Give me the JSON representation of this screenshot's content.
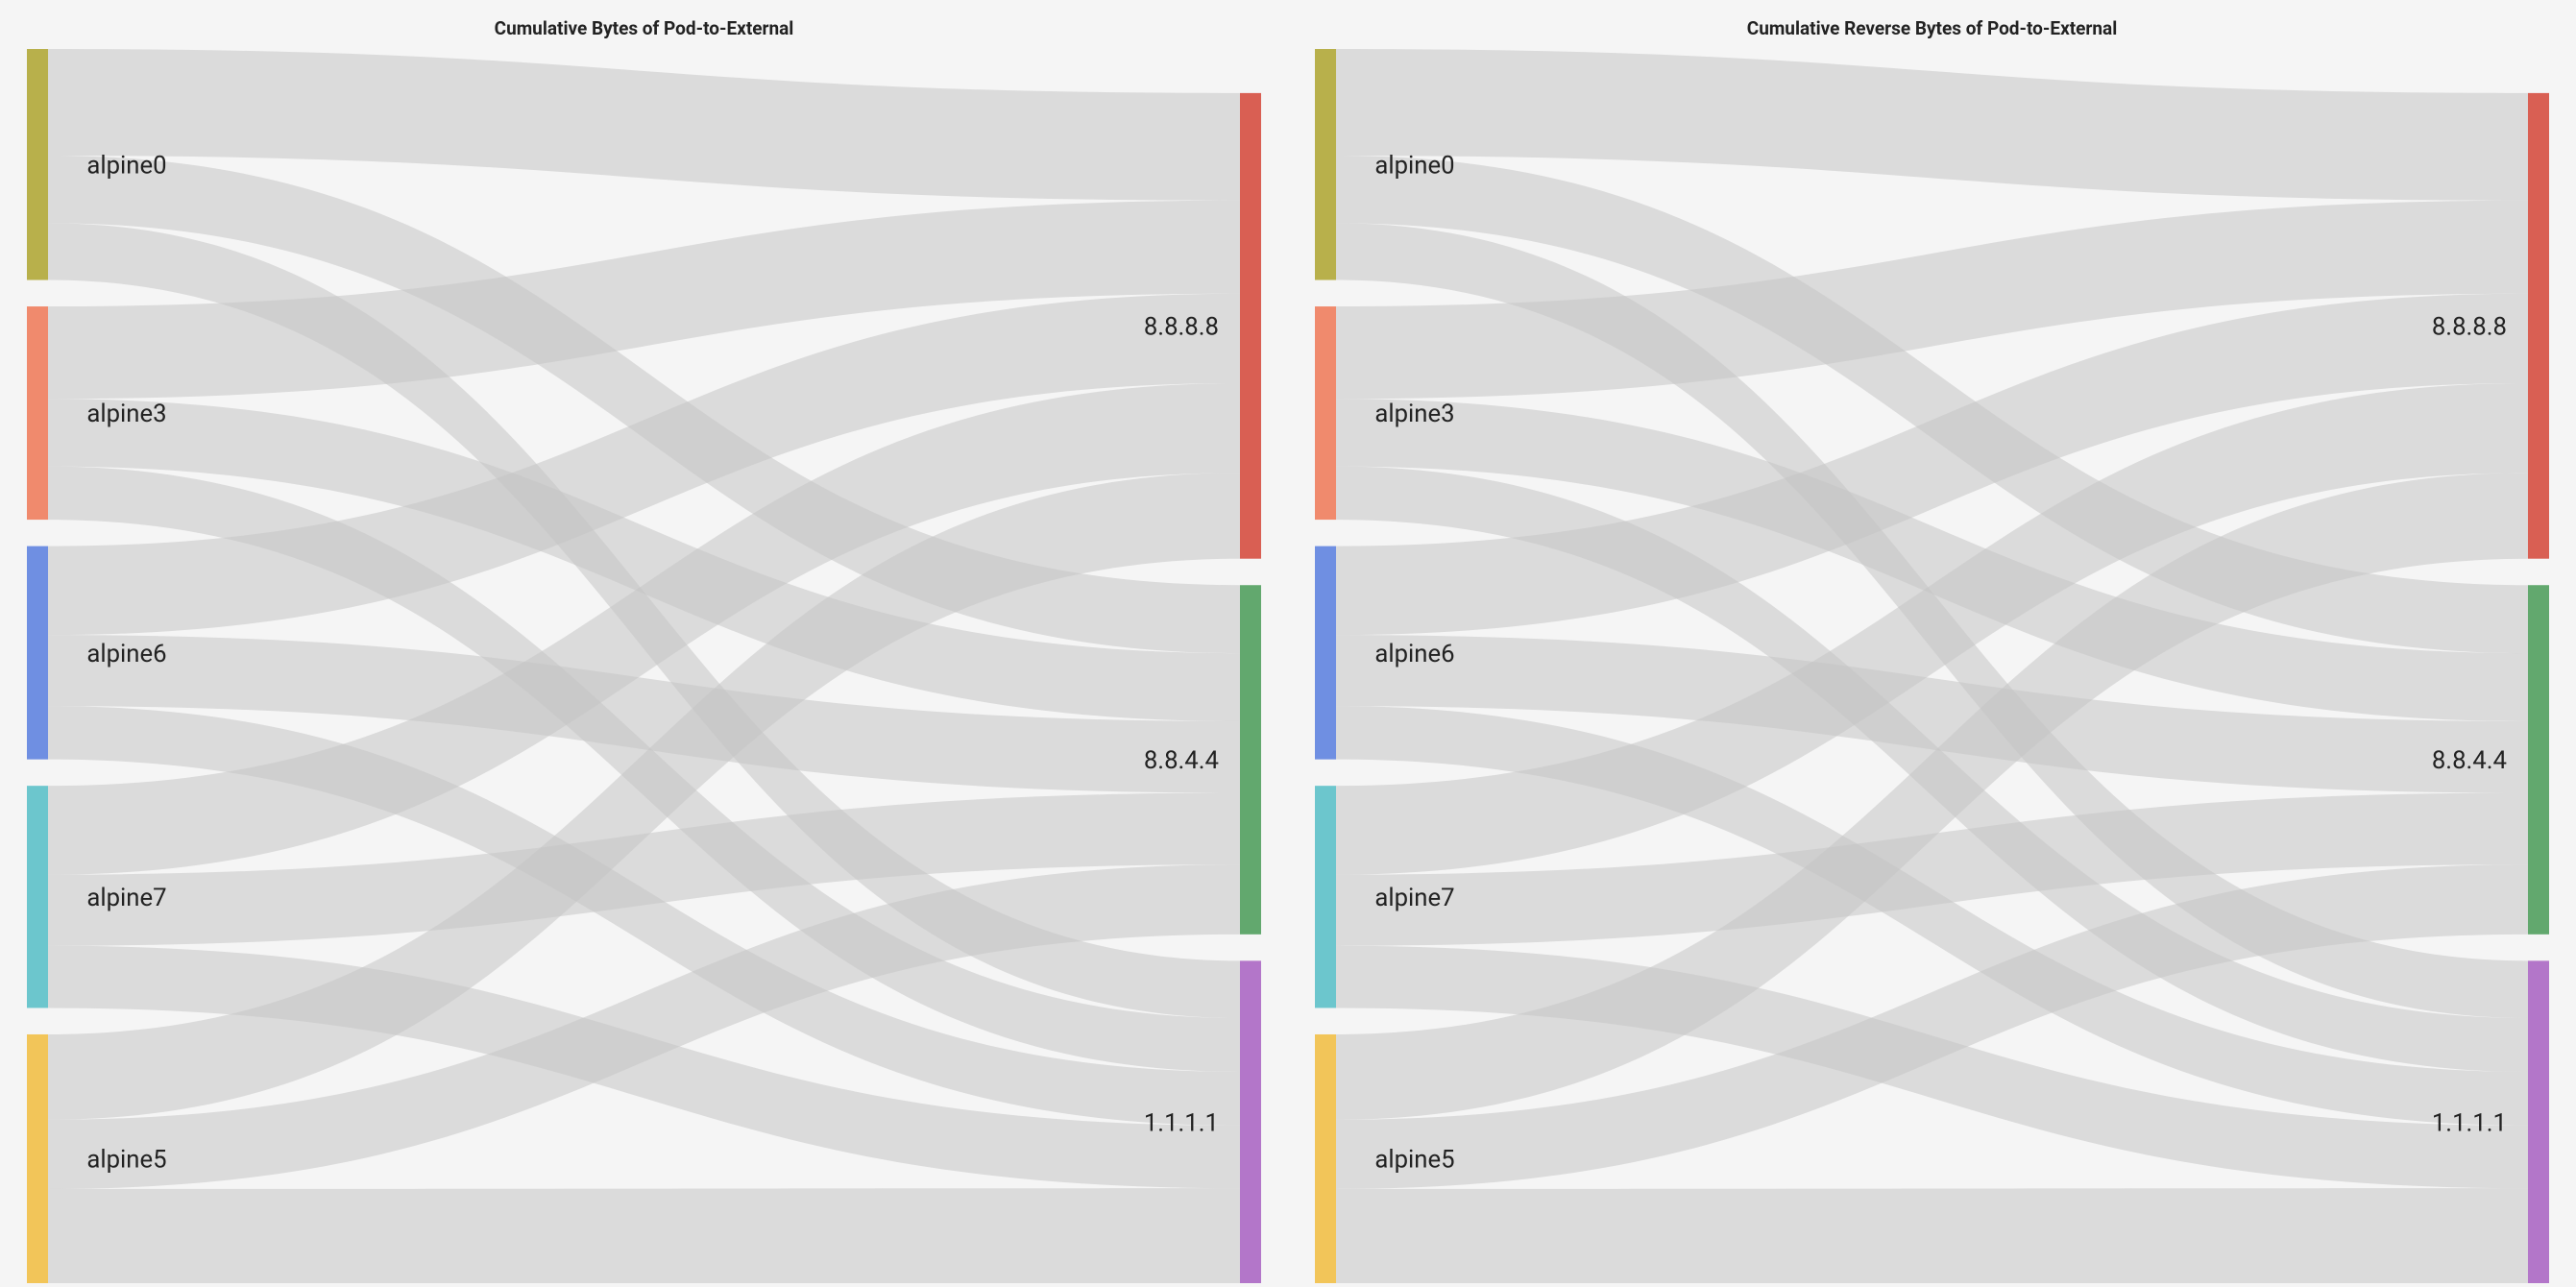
{
  "panels": [
    {
      "title": "Cumulative Bytes of Pod-to-External"
    },
    {
      "title": "Cumulative Reverse Bytes of Pod-to-External"
    }
  ],
  "chart_data": [
    {
      "type": "sankey",
      "title": "Cumulative Bytes of Pod-to-External",
      "sources": [
        "alpine0",
        "alpine3",
        "alpine6",
        "alpine7",
        "alpine5"
      ],
      "targets": [
        "8.8.8.8",
        "8.8.4.4",
        "1.1.1.1"
      ],
      "source_totals": {
        "alpine0": 130,
        "alpine3": 120,
        "alpine6": 120,
        "alpine7": 125,
        "alpine5": 140
      },
      "target_totals": {
        "8.8.8.8": 260,
        "8.8.4.4": 195,
        "1.1.1.1": 180
      },
      "flows": [
        {
          "source": "alpine0",
          "target": "8.8.8.8",
          "value": 60
        },
        {
          "source": "alpine0",
          "target": "8.8.4.4",
          "value": 38
        },
        {
          "source": "alpine0",
          "target": "1.1.1.1",
          "value": 32
        },
        {
          "source": "alpine3",
          "target": "8.8.8.8",
          "value": 52
        },
        {
          "source": "alpine3",
          "target": "8.8.4.4",
          "value": 38
        },
        {
          "source": "alpine3",
          "target": "1.1.1.1",
          "value": 30
        },
        {
          "source": "alpine6",
          "target": "8.8.8.8",
          "value": 50
        },
        {
          "source": "alpine6",
          "target": "8.8.4.4",
          "value": 40
        },
        {
          "source": "alpine6",
          "target": "1.1.1.1",
          "value": 30
        },
        {
          "source": "alpine7",
          "target": "8.8.8.8",
          "value": 50
        },
        {
          "source": "alpine7",
          "target": "8.8.4.4",
          "value": 40
        },
        {
          "source": "alpine7",
          "target": "1.1.1.1",
          "value": 35
        },
        {
          "source": "alpine5",
          "target": "8.8.8.8",
          "value": 48
        },
        {
          "source": "alpine5",
          "target": "8.8.4.4",
          "value": 39
        },
        {
          "source": "alpine5",
          "target": "1.1.1.1",
          "value": 53
        }
      ],
      "colors": {
        "alpine0": "#b8b04b",
        "alpine3": "#f08a6d",
        "alpine6": "#6f8fe2",
        "alpine7": "#6cc6cd",
        "alpine5": "#f2c559",
        "8.8.8.8": "#d95f53",
        "8.8.4.4": "#62a86e",
        "1.1.1.1": "#b376c9"
      },
      "link_color": "#c4c4c4"
    },
    {
      "type": "sankey",
      "title": "Cumulative Reverse Bytes of Pod-to-External",
      "sources": [
        "alpine0",
        "alpine3",
        "alpine6",
        "alpine7",
        "alpine5"
      ],
      "targets": [
        "8.8.8.8",
        "8.8.4.4",
        "1.1.1.1"
      ],
      "source_totals": {
        "alpine0": 130,
        "alpine3": 120,
        "alpine6": 120,
        "alpine7": 125,
        "alpine5": 140
      },
      "target_totals": {
        "8.8.8.8": 260,
        "8.8.4.4": 195,
        "1.1.1.1": 180
      },
      "flows": [
        {
          "source": "alpine0",
          "target": "8.8.8.8",
          "value": 60
        },
        {
          "source": "alpine0",
          "target": "8.8.4.4",
          "value": 38
        },
        {
          "source": "alpine0",
          "target": "1.1.1.1",
          "value": 32
        },
        {
          "source": "alpine3",
          "target": "8.8.8.8",
          "value": 52
        },
        {
          "source": "alpine3",
          "target": "8.8.4.4",
          "value": 38
        },
        {
          "source": "alpine3",
          "target": "1.1.1.1",
          "value": 30
        },
        {
          "source": "alpine6",
          "target": "8.8.8.8",
          "value": 50
        },
        {
          "source": "alpine6",
          "target": "8.8.4.4",
          "value": 40
        },
        {
          "source": "alpine6",
          "target": "1.1.1.1",
          "value": 30
        },
        {
          "source": "alpine7",
          "target": "8.8.8.8",
          "value": 50
        },
        {
          "source": "alpine7",
          "target": "8.8.4.4",
          "value": 40
        },
        {
          "source": "alpine7",
          "target": "1.1.1.1",
          "value": 35
        },
        {
          "source": "alpine5",
          "target": "8.8.8.8",
          "value": 48
        },
        {
          "source": "alpine5",
          "target": "8.8.4.4",
          "value": 39
        },
        {
          "source": "alpine5",
          "target": "1.1.1.1",
          "value": 53
        }
      ],
      "colors": {
        "alpine0": "#b8b04b",
        "alpine3": "#f08a6d",
        "alpine6": "#6f8fe2",
        "alpine7": "#6cc6cd",
        "alpine5": "#f2c559",
        "8.8.8.8": "#d95f53",
        "8.8.4.4": "#62a86e",
        "1.1.1.1": "#b376c9"
      },
      "link_color": "#c4c4c4"
    }
  ]
}
